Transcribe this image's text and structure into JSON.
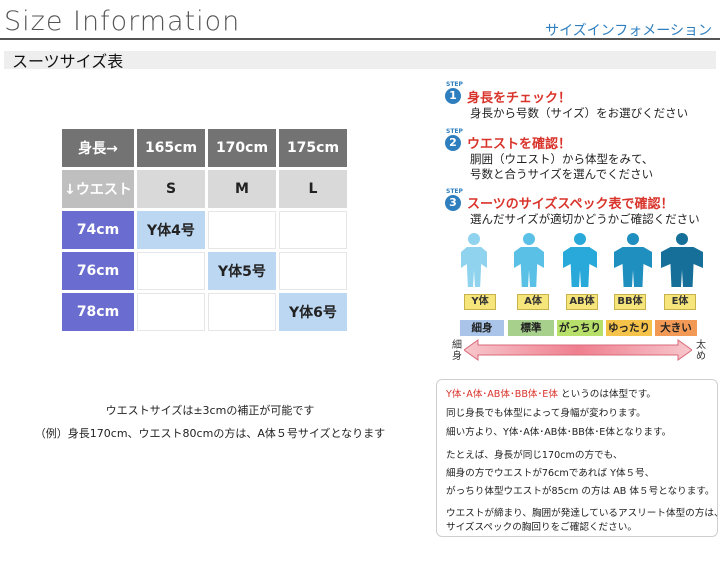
{
  "header": {
    "title": "Size Information",
    "title_jp": "サイズインフォメーション",
    "subtitle": "スーツサイズ表"
  },
  "table": {
    "corner_height": "身長→",
    "corner_waist": "↓ウエスト",
    "heights": [
      "165cm",
      "170cm",
      "175cm"
    ],
    "sizes": [
      "S",
      "M",
      "L"
    ],
    "rows": [
      {
        "waist": "74cm",
        "cells": [
          "Y体4号",
          "",
          ""
        ]
      },
      {
        "waist": "76cm",
        "cells": [
          "",
          "Y体5号",
          ""
        ]
      },
      {
        "waist": "78cm",
        "cells": [
          "",
          "",
          "Y体6号"
        ]
      }
    ]
  },
  "notes": {
    "line1": "ウエストサイズは±3cmの補正が可能です",
    "line2": "（例）身長170cm、ウエスト80cmの方は、A体５号サイズとなります"
  },
  "steps": [
    {
      "tag": "STEP",
      "num": "1",
      "title": "身長をチェック！",
      "lines": [
        "身長から号数（サイズ）をお選びください"
      ]
    },
    {
      "tag": "STEP",
      "num": "2",
      "title": "ウエストを確認！",
      "lines": [
        "胴囲（ウエスト）から体型をみて、",
        "号数と合うサイズを選んでください"
      ]
    },
    {
      "tag": "STEP",
      "num": "3",
      "title": "スーツのサイズスペック表で確認！",
      "lines": [
        "選んだサイズが適切かどうかご確認ください"
      ]
    }
  ],
  "body_types": {
    "types": [
      "Y体",
      "A体",
      "AB体",
      "BB体",
      "E体"
    ],
    "builds": [
      "細身",
      "標準",
      "がっちり",
      "ゆったり",
      "大きい"
    ],
    "build_colors": [
      "#a9c4e8",
      "#a8d08d",
      "#b7e06a",
      "#f6c34a",
      "#f29a55"
    ],
    "figure_colors": [
      "#8fd3ee",
      "#5bc0e6",
      "#29a9d9",
      "#1e8fbf",
      "#156f99"
    ],
    "scale_left": "細身",
    "scale_right": "太め"
  },
  "info": {
    "highlight": "Y体･A体･AB体･BB体･E体",
    "line1_rest": " というのは体型です。",
    "line2": "同じ身長でも体型によって身幅が変わります。",
    "line3": "細い方より、Y体･A体･AB体･BB体･E体となります。",
    "line4": "たとえば、身長が同じ170cmの方でも、",
    "line5": "細身の方でウエストが76cmであれば Y体５号、",
    "line6": "がっちり体型ウエストが85cm の方は AB 体５号となります。",
    "line7": "ウエストが締まり、胸囲が発達しているアスリート体型の方は、",
    "line8": "サイズスペックの胸回りをご確認ください。"
  },
  "colors": {
    "accent_blue": "#2f7fbf",
    "accent_red": "#d9342b",
    "row_label": "#6a6dcf",
    "highlight_cell": "#bcd7f2"
  }
}
